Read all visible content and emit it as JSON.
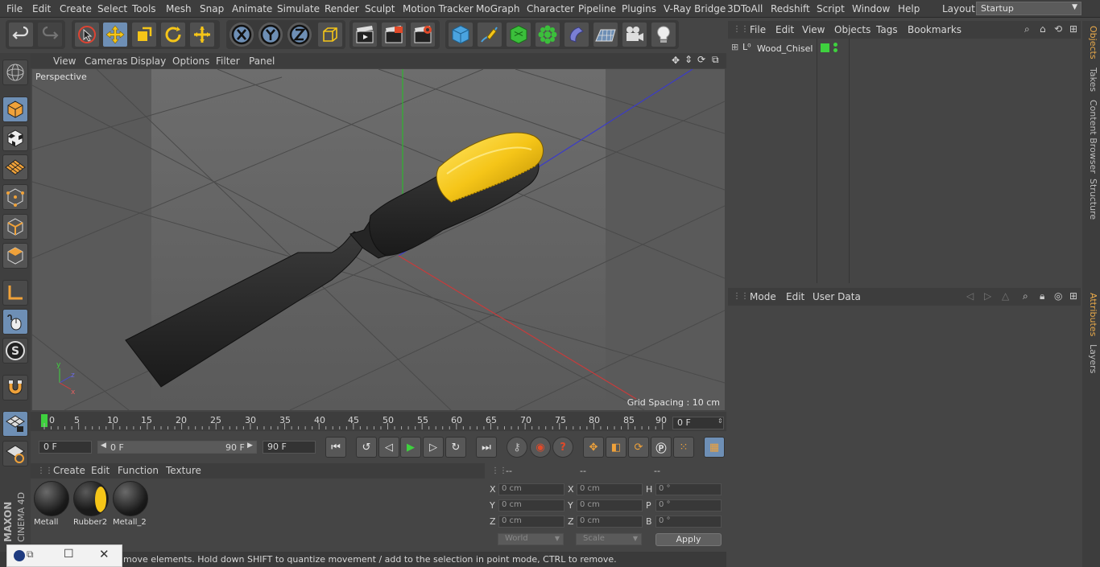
{
  "menubar": {
    "items": [
      "File",
      "Edit",
      "Create",
      "Select",
      "Tools",
      "Mesh",
      "Snap",
      "Animate",
      "Simulate",
      "Render",
      "Sculpt",
      "Motion Tracker",
      "MoGraph",
      "Character",
      "Pipeline",
      "Plugins",
      "V-Ray Bridge",
      "3DToAll",
      "Redshift",
      "Script",
      "Window",
      "Help"
    ],
    "layout_label": "Layout:",
    "layout_value": "Startup"
  },
  "viewport": {
    "menu": [
      "View",
      "Cameras",
      "Display",
      "Options",
      "Filter",
      "Panel"
    ],
    "label": "Perspective",
    "grid_spacing": "Grid Spacing : 10 cm"
  },
  "timeline": {
    "ticks": [
      "0",
      "5",
      "10",
      "15",
      "20",
      "25",
      "30",
      "35",
      "40",
      "45",
      "50",
      "55",
      "60",
      "65",
      "70",
      "75",
      "80",
      "85",
      "90"
    ],
    "current_frame": "0 F"
  },
  "transport": {
    "start_field": "0 F",
    "range_start": "0 F",
    "range_end": "90 F",
    "end_field": "90 F"
  },
  "materials": {
    "menu": [
      "Create",
      "Edit",
      "Function",
      "Texture"
    ],
    "items": [
      {
        "name": "Metall"
      },
      {
        "name": "Rubber2"
      },
      {
        "name": "Metall_2"
      }
    ]
  },
  "coords": {
    "headers": [
      "--",
      "--",
      "--"
    ],
    "rows": [
      {
        "l1": "X",
        "v1": "0 cm",
        "l2": "X",
        "v2": "0 cm",
        "l3": "H",
        "v3": "0 °"
      },
      {
        "l1": "Y",
        "v1": "0 cm",
        "l2": "Y",
        "v2": "0 cm",
        "l3": "P",
        "v3": "0 °"
      },
      {
        "l1": "Z",
        "v1": "0 cm",
        "l2": "Z",
        "v2": "0 cm",
        "l3": "B",
        "v3": "0 °"
      }
    ],
    "world": "World",
    "scale": "Scale",
    "apply": "Apply"
  },
  "objects": {
    "menu": [
      "File",
      "Edit",
      "View",
      "Objects",
      "Tags",
      "Bookmarks"
    ],
    "tree": [
      {
        "name": "Wood_Chisel"
      }
    ]
  },
  "attributes": {
    "menu": [
      "Mode",
      "Edit",
      "User Data"
    ]
  },
  "side_tabs": [
    "Objects",
    "Takes",
    "Content Browser",
    "Structure",
    "Attributes",
    "Layers"
  ],
  "status": "move elements. Hold down SHIFT to quantize movement / add to the selection in point mode, CTRL to remove.",
  "brand": "MAXON CINEMA 4D",
  "colors": {
    "accent": "#6e8fb5",
    "object_green": "#3ed13e",
    "handle_yellow": "#f5c518",
    "handle_dark": "#2b2b2b",
    "tab_active": "#e8a94a"
  }
}
